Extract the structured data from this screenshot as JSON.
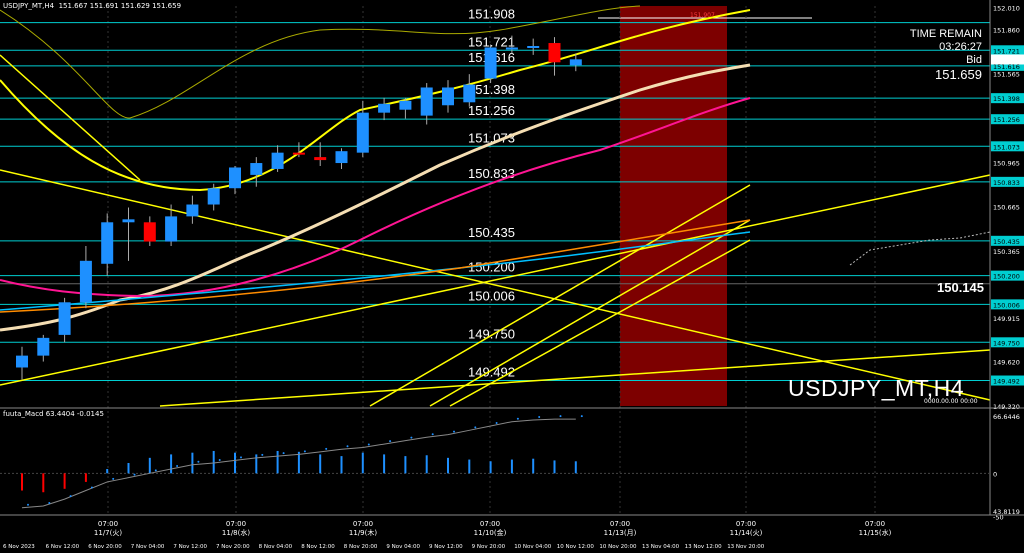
{
  "header": {
    "symbol_info": "USDJPY_MT,H4",
    "ohlc": "151.667 151.691 151.629 151.659"
  },
  "symbol_watermark": "USDJPY_MT,H4",
  "info_panel": {
    "time_label": "TIME REMAIN",
    "time_value": "03:26:27",
    "bid_label": "Bid",
    "bid_value": "151.659"
  },
  "current_level_label": "150.145",
  "high_marker": "151.907",
  "bottom_corner_text": "0000.00.00 00:00",
  "macd": {
    "label": "fuuta_Macd 63.4404 -0.0145",
    "axis": [
      "66.6446",
      "0",
      "-50",
      "43.8119"
    ]
  },
  "colors": {
    "background": "#000000",
    "bull": "#1e90ff",
    "bear": "#ff0000",
    "highlight": "#8b0000",
    "level_line": "#00ced1",
    "yellow": "#ffff00",
    "magenta": "#ff1493",
    "white_ma": "#f5deb3"
  },
  "chart_data": {
    "type": "candlestick",
    "title": "",
    "price_axis": {
      "range": [
        149.32,
        152.02
      ],
      "ticks": [
        "152.010",
        "151.860",
        "151.721",
        "151.616",
        "151.565",
        "151.398",
        "151.256",
        "151.073",
        "150.965",
        "150.833",
        "150.665",
        "150.435",
        "150.365",
        "150.200",
        "150.006",
        "149.915",
        "149.750",
        "149.620",
        "149.492",
        "149.320"
      ]
    },
    "key_levels": [
      151.908,
      151.721,
      151.616,
      151.398,
      151.256,
      151.073,
      150.833,
      150.435,
      150.2,
      150.006,
      149.75,
      149.492
    ],
    "x_axis": {
      "time_labels": [
        {
          "time": "07:00",
          "date": "11/7(火)"
        },
        {
          "time": "07:00",
          "date": "11/8(水)"
        },
        {
          "time": "07:00",
          "date": "11/9(木)"
        },
        {
          "time": "07:00",
          "date": "11/10(金)"
        },
        {
          "time": "07:00",
          "date": "11/13(月)"
        },
        {
          "time": "07:00",
          "date": "11/14(火)"
        },
        {
          "time": "07:00",
          "date": "11/15(水)"
        }
      ],
      "bottom_labels": [
        "6 Nov 2023",
        "6 Nov 12:00",
        "6 Nov 20:00",
        "7 Nov 04:00",
        "7 Nov 12:00",
        "7 Nov 20:00",
        "8 Nov 04:00",
        "8 Nov 12:00",
        "8 Nov 20:00",
        "9 Nov 04:00",
        "9 Nov 12:00",
        "9 Nov 20:00",
        "10 Nov 04:00",
        "10 Nov 12:00",
        "10 Nov 20:00",
        "13 Nov 04:00",
        "13 Nov 12:00",
        "13 Nov 20:00"
      ]
    },
    "candles": [
      {
        "o": 149.58,
        "h": 149.72,
        "l": 149.5,
        "c": 149.66
      },
      {
        "o": 149.66,
        "h": 149.8,
        "l": 149.62,
        "c": 149.78
      },
      {
        "o": 149.8,
        "h": 150.05,
        "l": 149.75,
        "c": 150.02
      },
      {
        "o": 150.02,
        "h": 150.4,
        "l": 149.98,
        "c": 150.3
      },
      {
        "o": 150.28,
        "h": 150.62,
        "l": 150.2,
        "c": 150.56
      },
      {
        "o": 150.56,
        "h": 150.66,
        "l": 150.3,
        "c": 150.58
      },
      {
        "o": 150.56,
        "h": 150.6,
        "l": 150.4,
        "c": 150.43
      },
      {
        "o": 150.43,
        "h": 150.68,
        "l": 150.4,
        "c": 150.6
      },
      {
        "o": 150.6,
        "h": 150.74,
        "l": 150.55,
        "c": 150.68
      },
      {
        "o": 150.68,
        "h": 150.82,
        "l": 150.64,
        "c": 150.79
      },
      {
        "o": 150.79,
        "h": 150.94,
        "l": 150.75,
        "c": 150.93
      },
      {
        "o": 150.88,
        "h": 151.0,
        "l": 150.8,
        "c": 150.96
      },
      {
        "o": 150.92,
        "h": 151.08,
        "l": 150.9,
        "c": 151.03
      },
      {
        "o": 151.03,
        "h": 151.1,
        "l": 151.0,
        "c": 151.02
      },
      {
        "o": 151.0,
        "h": 151.1,
        "l": 150.94,
        "c": 150.98
      },
      {
        "o": 150.96,
        "h": 151.06,
        "l": 150.92,
        "c": 151.04
      },
      {
        "o": 151.03,
        "h": 151.38,
        "l": 151.0,
        "c": 151.3
      },
      {
        "o": 151.3,
        "h": 151.4,
        "l": 151.25,
        "c": 151.36
      },
      {
        "o": 151.32,
        "h": 151.4,
        "l": 151.26,
        "c": 151.38
      },
      {
        "o": 151.28,
        "h": 151.5,
        "l": 151.22,
        "c": 151.47
      },
      {
        "o": 151.35,
        "h": 151.52,
        "l": 151.3,
        "c": 151.47
      },
      {
        "o": 151.37,
        "h": 151.56,
        "l": 151.34,
        "c": 151.49
      },
      {
        "o": 151.53,
        "h": 151.76,
        "l": 151.5,
        "c": 151.74
      },
      {
        "o": 151.74,
        "h": 151.82,
        "l": 151.7,
        "c": 151.74
      },
      {
        "o": 151.74,
        "h": 151.8,
        "l": 151.69,
        "c": 151.75
      },
      {
        "o": 151.77,
        "h": 151.81,
        "l": 151.55,
        "c": 151.64
      },
      {
        "o": 151.62,
        "h": 151.7,
        "l": 151.58,
        "c": 151.66
      }
    ],
    "macd_histogram": [
      -20,
      -22,
      -18,
      -10,
      5,
      12,
      18,
      22,
      24,
      26,
      24,
      22,
      26,
      25,
      22,
      20,
      24,
      22,
      20,
      21,
      18,
      16,
      14,
      16,
      17,
      15,
      14
    ],
    "macd_signal": [
      -40,
      -38,
      -30,
      -20,
      -10,
      -5,
      0,
      5,
      10,
      12,
      15,
      18,
      20,
      22,
      25,
      28,
      30,
      34,
      38,
      42,
      45,
      50,
      55,
      60,
      62,
      63,
      63
    ]
  }
}
